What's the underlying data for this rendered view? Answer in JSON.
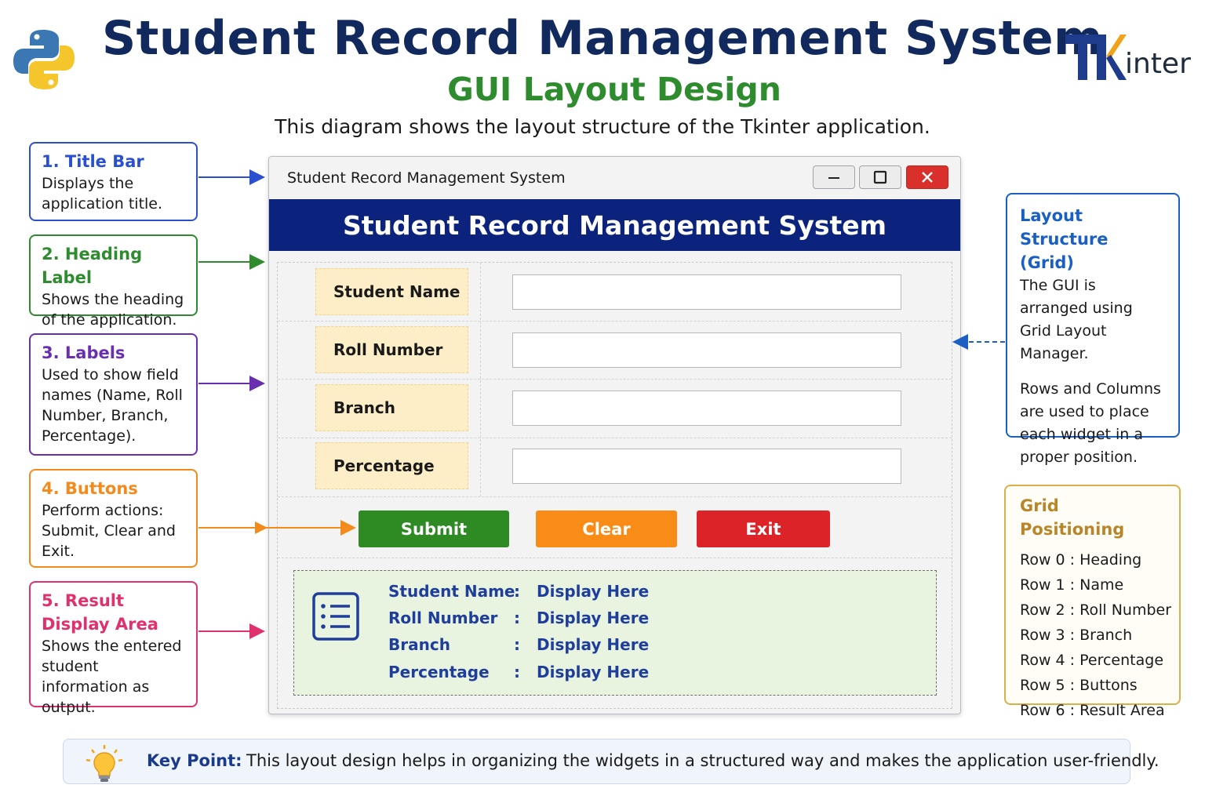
{
  "header": {
    "title": "Student Record Management System",
    "subtitle": "GUI Layout Design",
    "description": "This diagram shows the layout structure of the Tkinter application.",
    "tkinter_logo_suffix": "inter"
  },
  "callouts": [
    {
      "title": "1. Title Bar",
      "body": "Displays the application title."
    },
    {
      "title": "2. Heading Label",
      "body": "Shows the heading of the application."
    },
    {
      "title": "3. Labels",
      "body": "Used to show field names (Name, Roll Number, Branch, Percentage)."
    },
    {
      "title": "4. Buttons",
      "body": "Perform actions: Submit, Clear and Exit."
    },
    {
      "title": "5. Result Display Area",
      "body": "Shows the entered student information as output."
    }
  ],
  "layout_structure": {
    "title": "Layout Structure (Grid)",
    "para1": "The GUI is arranged using Grid Layout Manager.",
    "para2": "Rows and Columns are used to place each widget in a proper position."
  },
  "grid_positioning": {
    "title": "Grid Positioning",
    "rows": [
      "Row 0 : Heading",
      "Row 1 : Name",
      "Row 2 : Roll Number",
      "Row 3 : Branch",
      "Row 4 : Percentage",
      "Row 5 : Buttons",
      "Row 6 : Result Area"
    ]
  },
  "window": {
    "title": "Student Record Management System",
    "heading": "Student Record Management System",
    "fields": [
      {
        "label": "Student Name",
        "value": ""
      },
      {
        "label": "Roll Number",
        "value": ""
      },
      {
        "label": "Branch",
        "value": ""
      },
      {
        "label": "Percentage",
        "value": ""
      }
    ],
    "buttons": {
      "submit": "Submit",
      "clear": "Clear",
      "exit": "Exit"
    },
    "result": [
      {
        "label": "Student Name",
        "value": "Display Here"
      },
      {
        "label": "Roll Number",
        "value": "Display Here"
      },
      {
        "label": "Branch",
        "value": "Display Here"
      },
      {
        "label": "Percentage",
        "value": "Display Here"
      }
    ],
    "result_separator": ":"
  },
  "key_point": {
    "label": "Key Point:",
    "text": "This layout design helps in organizing the widgets in a structured way and makes the application user-friendly."
  },
  "icons": [
    "python-logo-icon",
    "tkinter-logo-icon",
    "minimize-icon",
    "maximize-icon",
    "close-icon",
    "list-icon",
    "lightbulb-icon"
  ],
  "colors": {
    "title": "#12295e",
    "subtitle": "#2e8b2e",
    "heading_bar": "#0c237e",
    "submit": "#2e8b24",
    "clear": "#f88c17",
    "exit": "#dc2328",
    "label_bg": "#fdeec7",
    "result_bg": "#e8f3e0"
  }
}
